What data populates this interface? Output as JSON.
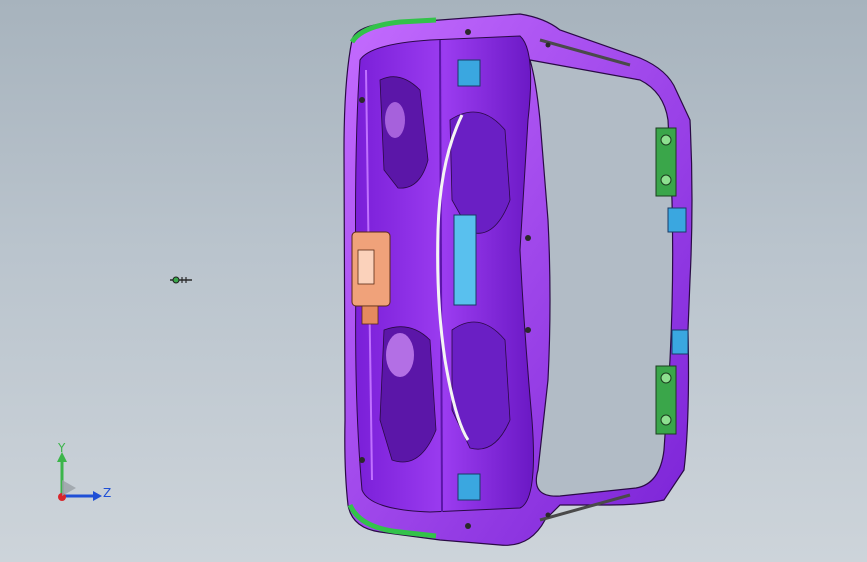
{
  "viewport": {
    "background_top": "#a7b3bd",
    "background_bottom": "#cdd4da"
  },
  "model": {
    "colors": {
      "body": "#8a2be2",
      "body_dark": "#5b16a8",
      "body_light": "#c070ff",
      "edge": "#2a0a45",
      "seal_green": "#33c24a",
      "clip_green": "#3aa64a",
      "bracket_blue": "#3aa7e0",
      "latch_orange": "#f0a27a",
      "cable": "#f4f4f4"
    }
  },
  "triad": {
    "y_label": "Y",
    "z_label": "Z",
    "y_color": "#3bb54a",
    "z_color": "#1f4fd6",
    "x_color": "#d8262c"
  },
  "orientation_marker": {
    "icon": "small-part-icon"
  }
}
